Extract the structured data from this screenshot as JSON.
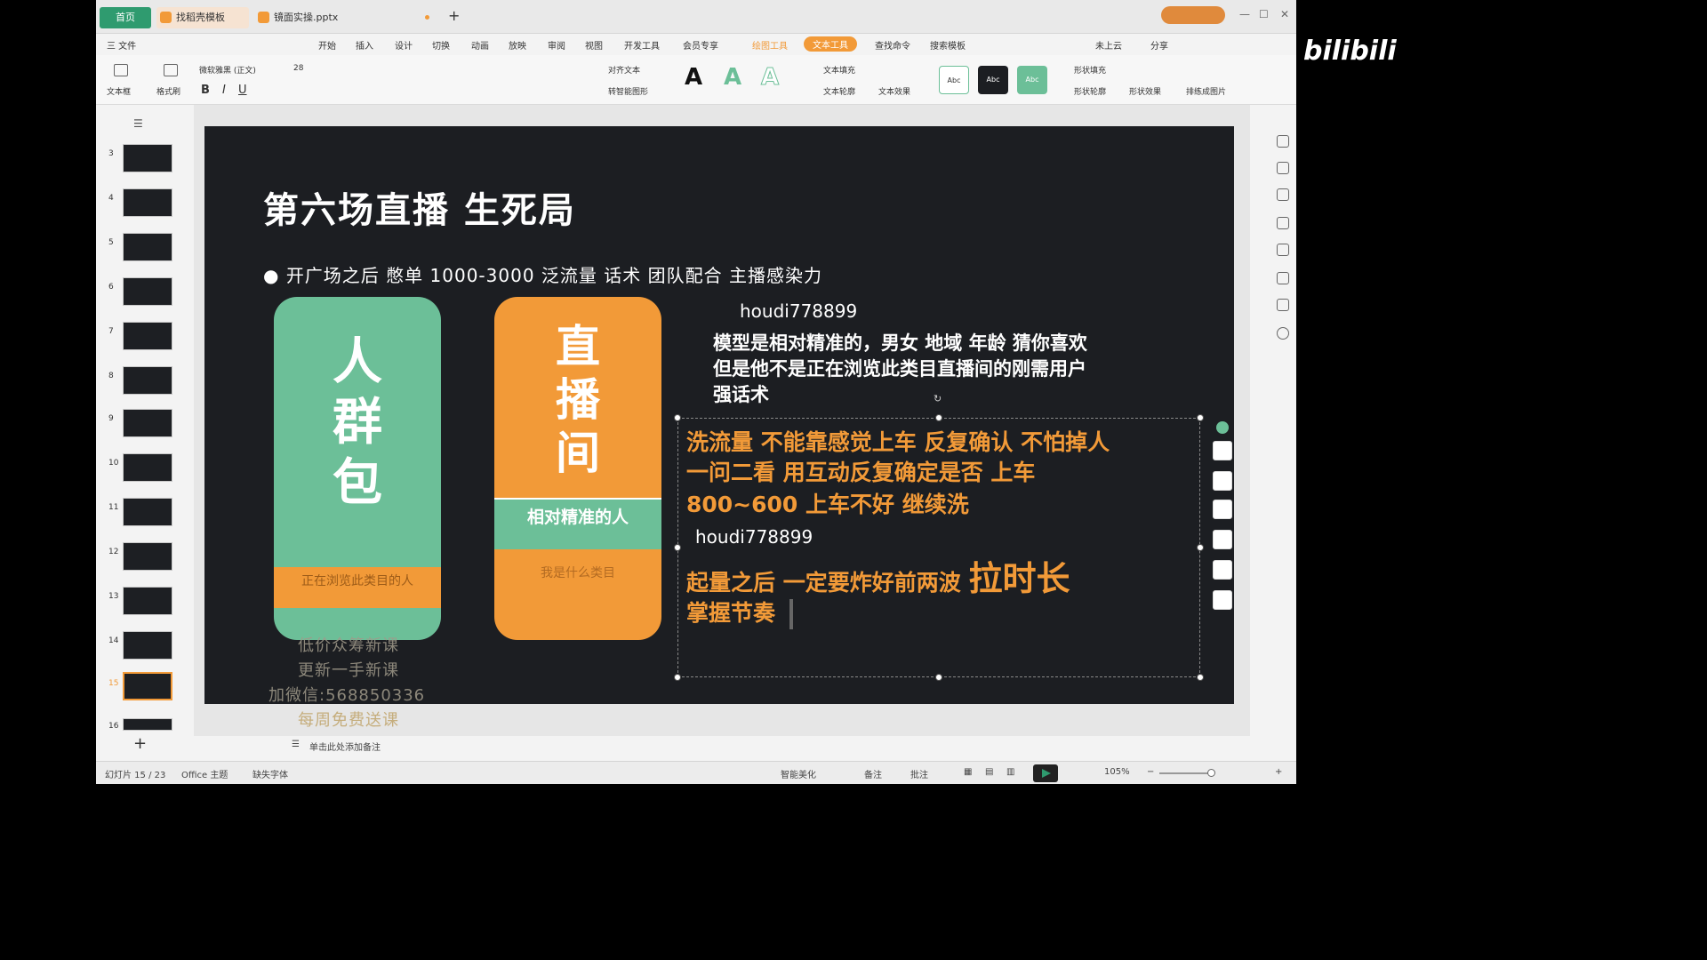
{
  "tabs": {
    "home": "首页",
    "tab1": "找稻壳模板",
    "tab2": "镜面实操.pptx"
  },
  "menu": [
    "三 文件",
    "开始",
    "插入",
    "设计",
    "切换",
    "动画",
    "放映",
    "审阅",
    "视图",
    "开发工具",
    "会员专享",
    "绘图工具",
    "文本工具",
    "查找命令",
    "搜索模板",
    "未上云",
    "分享"
  ],
  "ribbon": {
    "textbox": "文本框",
    "format_brush": "格式刷",
    "font_name": "微软雅黑 (正文)",
    "font_size": "28",
    "align_text": "对齐文本",
    "convert_smartart": "转智能图形",
    "text_fill": "文本填充",
    "text_outline": "文本轮廓",
    "text_effect": "文本效果",
    "shape_fill": "形状填充",
    "shape_outline": "形状轮廓",
    "shape_effect": "形状效果",
    "arrange": "排练成图片",
    "style_abc": "Abc"
  },
  "slide_numbers": [
    "3",
    "4",
    "5",
    "6",
    "7",
    "8",
    "9",
    "10",
    "11",
    "12",
    "13",
    "14",
    "15",
    "16"
  ],
  "slide": {
    "title": "第六场直播 生死局",
    "bullet": "开广场之后 憋单 1000-3000 泛流量  话术 团队配合 主播感染力",
    "card1": {
      "text": "人群包",
      "band": "正在浏览此类目的人"
    },
    "card2": {
      "text": "直播间",
      "band": "相对精准的人",
      "sub": "我是什么类目"
    },
    "code1": "houdi778899",
    "para": [
      "模型是相对精准的，男女 地域 年龄 猜你喜欢",
      "但是他不是正在浏览此类目直播间的刚需用户",
      "强话术"
    ],
    "orange_lines": [
      "洗流量  不能靠感觉上车  反复确认  不怕掉人",
      "一问二看  用互动反复确定是否  上车",
      "800~600  上车不好  继续洗"
    ],
    "code2": "houdi778899",
    "final1_a": "起量之后 一定要炸好前两波",
    "final1_b": "拉时长",
    "final2": "掌握节奏"
  },
  "watermark": [
    "低价众筹新课",
    "更新一手新课",
    "加微信:568850336",
    "每周免费送课"
  ],
  "notes_placeholder": "单击此处添加备注",
  "status": {
    "slide_counter": "幻灯片 15 / 23",
    "theme": "Office 主题",
    "missing_font": "缺失字体",
    "beautify": "智能美化",
    "notes": "备注",
    "comments": "批注",
    "zoom": "105%"
  },
  "brand_watermark": "bilibili"
}
